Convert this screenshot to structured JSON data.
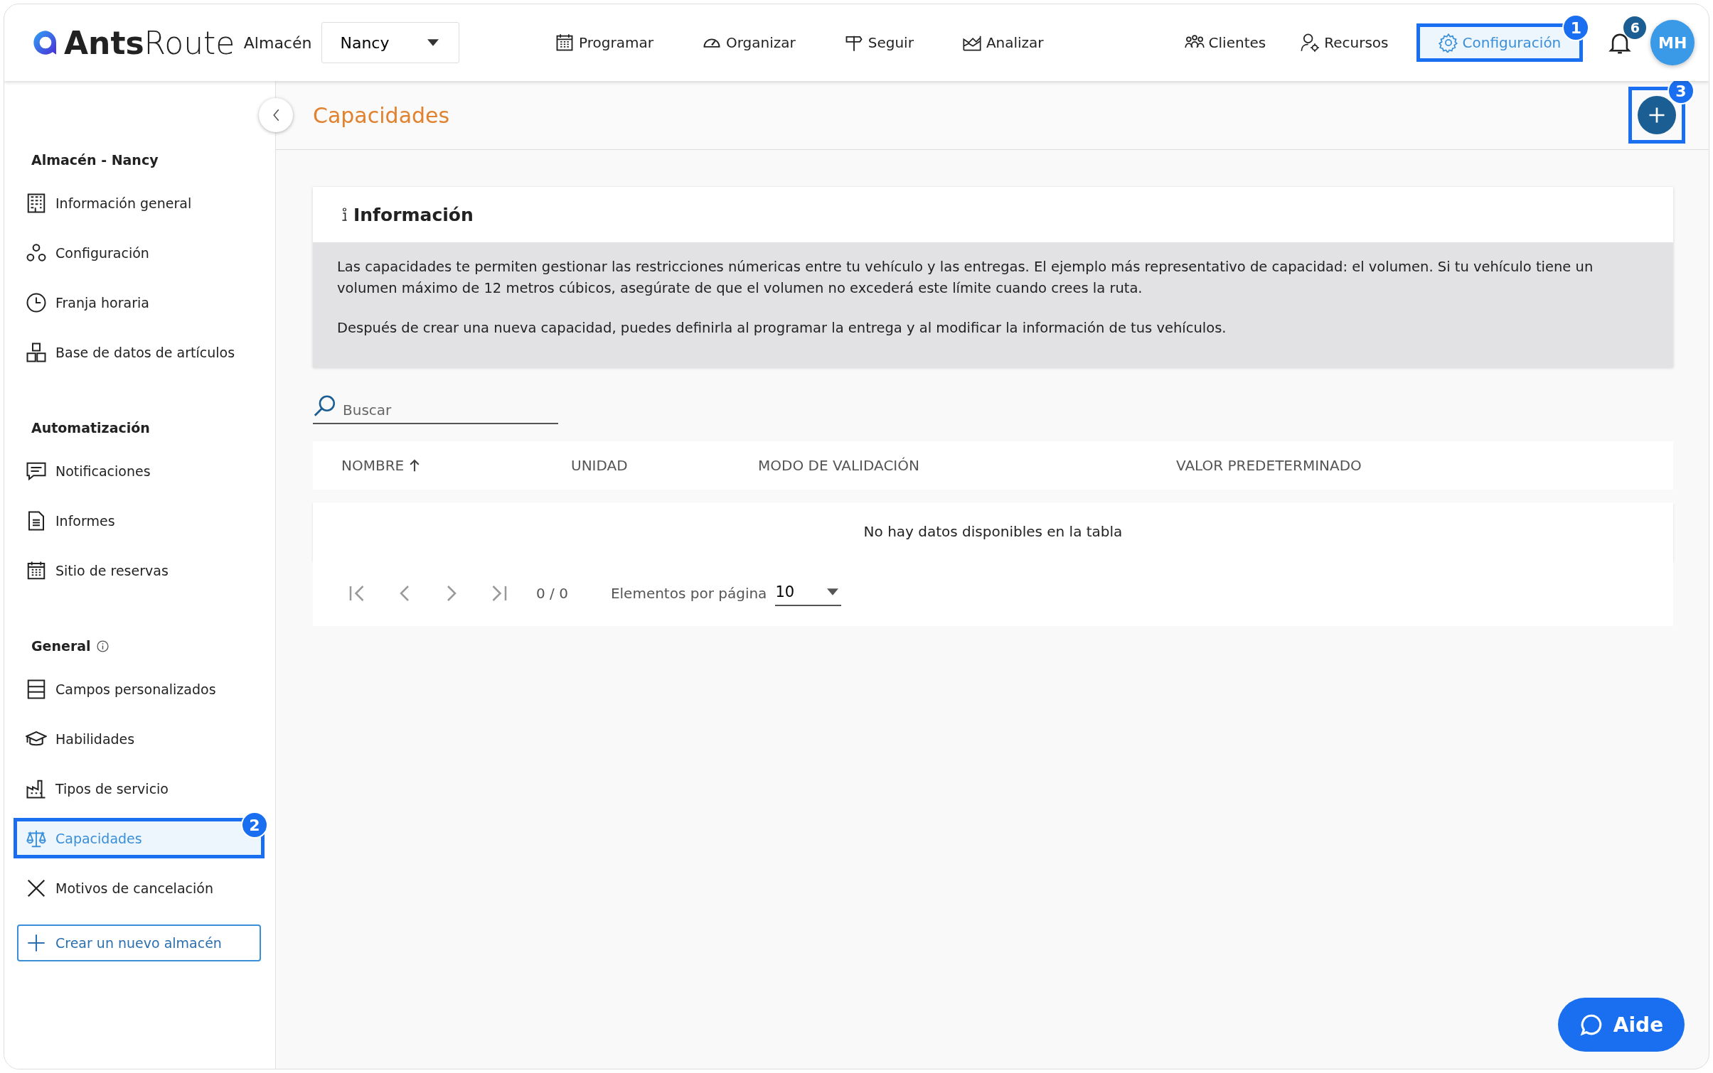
{
  "header": {
    "logo_bold": "Ants",
    "logo_light": "Route",
    "warehouse_label": "Almacén",
    "warehouse_value": "Nancy",
    "nav": [
      {
        "label": "Programar",
        "selected": false
      },
      {
        "label": "Organizar",
        "selected": false
      },
      {
        "label": "Seguir",
        "selected": false
      },
      {
        "label": "Analizar",
        "selected": false
      }
    ],
    "nav_right": [
      {
        "label": "Clientes",
        "selected": false
      },
      {
        "label": "Recursos",
        "selected": false
      },
      {
        "label": "Configuración",
        "selected": true,
        "callout": "1"
      }
    ],
    "notifications": "6",
    "avatar": "MH"
  },
  "sidebar": {
    "sections": [
      {
        "title": "Almacén - Nancy",
        "info": false,
        "items": [
          {
            "label": "Información general",
            "selected": false
          },
          {
            "label": "Configuración",
            "selected": false
          },
          {
            "label": "Franja horaria",
            "selected": false
          },
          {
            "label": "Base de datos de artículos",
            "selected": false
          }
        ]
      },
      {
        "title": "Automatización",
        "info": false,
        "items": [
          {
            "label": "Notificaciones",
            "selected": false
          },
          {
            "label": "Informes",
            "selected": false
          },
          {
            "label": "Sitio de reservas",
            "selected": false
          }
        ]
      },
      {
        "title": "General",
        "info": true,
        "items": [
          {
            "label": "Campos personalizados",
            "selected": false
          },
          {
            "label": "Habilidades",
            "selected": false
          },
          {
            "label": "Tipos de servicio",
            "selected": false
          },
          {
            "label": "Capacidades",
            "selected": true,
            "callout": "2"
          },
          {
            "label": "Motivos de cancelación",
            "selected": false
          }
        ]
      }
    ],
    "create_button": "Crear un nuevo almacén"
  },
  "page": {
    "title": "Capacidades",
    "add_callout": "3",
    "info": {
      "title": "Información",
      "paragraphs": [
        "Las capacidades te permiten gestionar las restricciones númericas entre tu vehículo y las entregas. El ejemplo más representativo de capacidad: el volumen. Si tu vehículo tiene un volumen máximo de 12 metros cúbicos, asegúrate de que el volumen no excederá este límite cuando crees la ruta.",
        "Después de crear una nueva capacidad, puedes definirla al programar la entrega y al modificar la información de tus vehículos."
      ]
    },
    "search": {
      "placeholder": "Buscar"
    },
    "table": {
      "columns": [
        {
          "label": "NOMBRE",
          "sorted": true
        },
        {
          "label": "UNIDAD",
          "sorted": false
        },
        {
          "label": "MODO DE VALIDACIÓN",
          "sorted": false
        },
        {
          "label": "VALOR PREDETERMINADO",
          "sorted": false
        }
      ],
      "empty": "No hay datos disponibles en la tabla"
    },
    "pagination": {
      "range": "0 / 0",
      "per_page_label": "Elementos por página",
      "per_page": "10"
    }
  },
  "help_button": "Aide"
}
